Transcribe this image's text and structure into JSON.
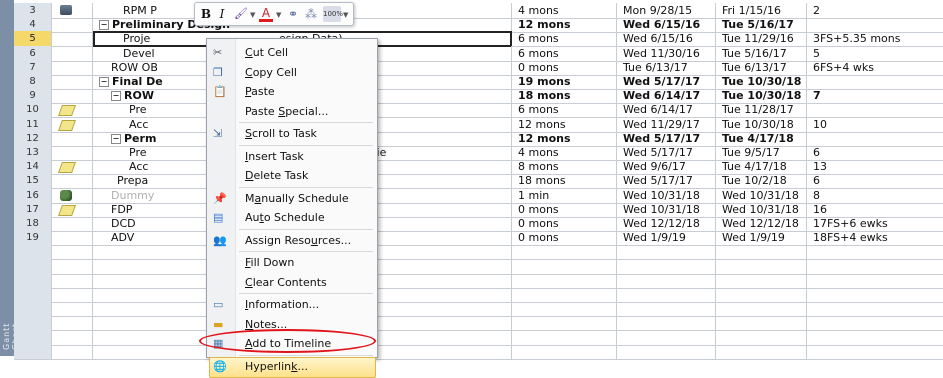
{
  "sidebar": {
    "label": "Gantt Chart"
  },
  "rows": [
    {
      "id": "3",
      "name": "RPM P",
      "bold": false,
      "indent": 5,
      "duration": "4 mons",
      "start": "Mon 9/28/15",
      "finish": "Fri 1/15/16",
      "pred": "2",
      "icon": "schedule"
    },
    {
      "id": "4",
      "name": "Preliminary Design",
      "bold": true,
      "indent": 1,
      "collapse": "−",
      "duration": "12 mons",
      "start": "Wed 6/15/16",
      "finish": "Tue 5/16/17",
      "pred": ""
    },
    {
      "id": "5",
      "name": "Proje",
      "suffix": "esign Data)",
      "bold": false,
      "indent": 5,
      "duration": "6 mons",
      "start": "Wed 6/15/16",
      "finish": "Tue 11/29/16",
      "pred": "3FS+5.35 mons",
      "selected": true
    },
    {
      "id": "6",
      "name": "Devel",
      "suffix": "proval",
      "bold": false,
      "indent": 5,
      "duration": "6 mons",
      "start": "Wed 11/30/16",
      "finish": "Tue 5/16/17",
      "pred": "5"
    },
    {
      "id": "7",
      "name": "ROW OB",
      "bold": false,
      "indent": 3,
      "duration": "0 mons",
      "start": "Tue 6/13/17",
      "finish": "Tue 6/13/17",
      "pred": "6FS+4 wks"
    },
    {
      "id": "8",
      "name": "Final De",
      "bold": true,
      "indent": 1,
      "collapse": "−",
      "duration": "19 mons",
      "start": "Wed 5/17/17",
      "finish": "Tue 10/30/18",
      "pred": ""
    },
    {
      "id": "9",
      "name": "ROW",
      "bold": true,
      "indent": 3,
      "collapse": "−",
      "duration": "18 mons",
      "start": "Wed 6/14/17",
      "finish": "Tue 10/30/18",
      "pred": "7",
      "predbold": true
    },
    {
      "id": "10",
      "name": "Pre",
      "suffix": "ROW",
      "bold": false,
      "indent": 6,
      "duration": "6 mons",
      "start": "Wed 6/14/17",
      "finish": "Tue 11/28/17",
      "pred": "",
      "icon": "note"
    },
    {
      "id": "11",
      "name": "Acc",
      "bold": false,
      "indent": 6,
      "duration": "12 mons",
      "start": "Wed 11/29/17",
      "finish": "Tue 10/30/18",
      "pred": "10",
      "icon": "note"
    },
    {
      "id": "12",
      "name": "Perm",
      "bold": true,
      "indent": 3,
      "collapse": "−",
      "duration": "12 mons",
      "start": "Wed 5/17/17",
      "finish": "Tue 4/17/18",
      "pred": ""
    },
    {
      "id": "13",
      "name": "Pre",
      "suffix": "Regulatory Agencie",
      "bold": false,
      "indent": 6,
      "duration": "4 mons",
      "start": "Wed 5/17/17",
      "finish": "Tue 9/5/17",
      "pred": "6"
    },
    {
      "id": "14",
      "name": "Acc",
      "bold": false,
      "indent": 6,
      "duration": "8 mons",
      "start": "Wed 9/6/17",
      "finish": "Tue 4/17/18",
      "pred": "13",
      "icon": "note"
    },
    {
      "id": "15",
      "name": "Prepa",
      "suffix": "n",
      "bold": false,
      "indent": 4,
      "duration": "18 mons",
      "start": "Wed 5/17/17",
      "finish": "Tue 10/2/18",
      "pred": "6"
    },
    {
      "id": "16",
      "name": "Dummy",
      "bold": false,
      "gray": true,
      "indent": 3,
      "duration": "1 min",
      "start": "Wed 10/31/18",
      "finish": "Wed 10/31/18",
      "pred": "8",
      "icon": "resource"
    },
    {
      "id": "17",
      "name": "FDP",
      "bold": false,
      "indent": 3,
      "duration": "0 mons",
      "start": "Wed 10/31/18",
      "finish": "Wed 10/31/18",
      "pred": "16",
      "icon": "note"
    },
    {
      "id": "18",
      "name": "DCD",
      "bold": false,
      "indent": 3,
      "duration": "0 mons",
      "start": "Wed 12/12/18",
      "finish": "Wed 12/12/18",
      "pred": "17FS+6 ewks"
    },
    {
      "id": "19",
      "name": "ADV",
      "bold": false,
      "indent": 3,
      "duration": "0 mons",
      "start": "Wed 1/9/19",
      "finish": "Wed 1/9/19",
      "pred": "18FS+4 ewks"
    }
  ],
  "minitoolbar": {
    "bold": "B",
    "italic": "I",
    "fill": "🖌",
    "font_color": "A",
    "link": "⚭",
    "scroll": "⁂",
    "percent": "100%"
  },
  "menu": [
    {
      "label": "Cut Cell",
      "icon": "scissors-icon",
      "ul": "C"
    },
    {
      "label": "Copy Cell",
      "icon": "copy-icon",
      "ul": "C"
    },
    {
      "label": "Paste",
      "icon": "paste-icon",
      "ul": "P"
    },
    {
      "label": "Paste Special...",
      "icon": "",
      "ul": "S"
    },
    {
      "sep": true
    },
    {
      "label": "Scroll to Task",
      "icon": "scroll-icon",
      "ul": "S"
    },
    {
      "sep": true
    },
    {
      "label": "Insert Task",
      "icon": "",
      "ul": "I"
    },
    {
      "label": "Delete Task",
      "icon": "",
      "ul": "D"
    },
    {
      "sep": true
    },
    {
      "label": "Manually Schedule",
      "icon": "pin-icon",
      "ul": "a"
    },
    {
      "label": "Auto Schedule",
      "icon": "auto-schedule-icon",
      "ul": "t"
    },
    {
      "sep": true
    },
    {
      "label": "Assign Resources...",
      "icon": "resources-icon",
      "ul": "u"
    },
    {
      "sep": true
    },
    {
      "label": "Fill Down",
      "icon": "",
      "ul": "F"
    },
    {
      "label": "Clear Contents",
      "icon": "",
      "ul": "C"
    },
    {
      "sep": true
    },
    {
      "label": "Information...",
      "icon": "info-icon",
      "ul": "I"
    },
    {
      "label": "Notes...",
      "icon": "notes-icon",
      "ul": "N"
    },
    {
      "label": "Add to Timeline",
      "icon": "timeline-icon",
      "ul": "A"
    },
    {
      "sep": true
    },
    {
      "label": "Hyperlink...",
      "icon": "hyperlink-icon",
      "ul": "k",
      "highlight": true
    }
  ]
}
